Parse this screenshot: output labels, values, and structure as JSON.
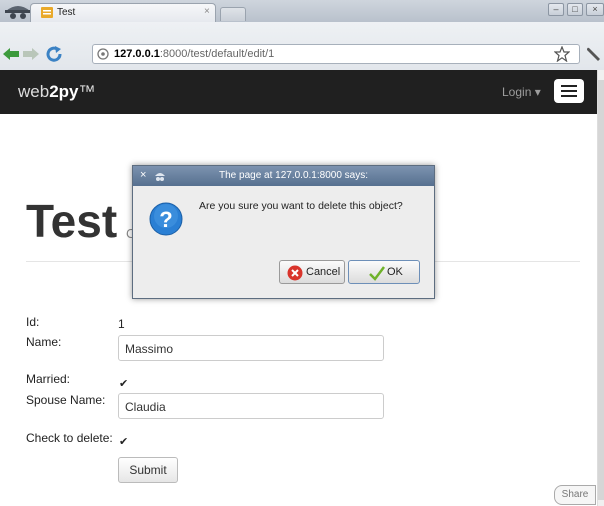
{
  "browser": {
    "tab_title": "Test",
    "tab_close": "×",
    "url_host": "127.0.0.1",
    "url_path": ":8000/test/default/edit/1",
    "window_buttons": [
      "–",
      "□",
      "×"
    ]
  },
  "navbar": {
    "brand_prefix": "web",
    "brand_bold": "2py",
    "brand_suffix": "™",
    "login_label": "Login ▾"
  },
  "page": {
    "title": "Test",
    "subtitle": "C"
  },
  "form": {
    "id_label": "Id:",
    "id_value": "1",
    "name_label": "Name:",
    "name_value": "Massimo",
    "married_label": "Married:",
    "married_check": "✔",
    "spouse_label": "Spouse Name:",
    "spouse_value": "Claudia",
    "delete_label": "Check to delete:",
    "delete_check": "✔",
    "submit_label": "Submit"
  },
  "share_label": "Share",
  "dialog": {
    "title": "The page at 127.0.0.1:8000 says:",
    "close": "×",
    "message": "Are you sure you want to delete this object?",
    "cancel_label": "Cancel",
    "ok_label": "OK"
  },
  "colors": {
    "navbar": "#202020",
    "dialog_title": "#56708f",
    "question_icon": "#2a7fd4",
    "cancel_icon": "#d9342b",
    "ok_icon": "#6fb22a"
  }
}
